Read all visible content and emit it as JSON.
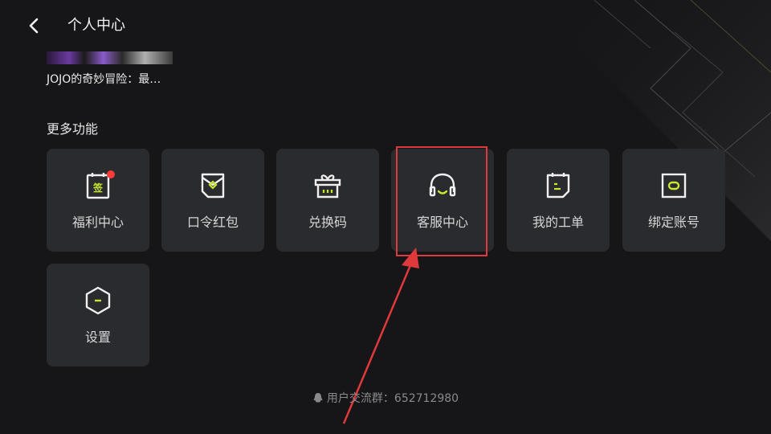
{
  "header": {
    "title": "个人中心"
  },
  "recent": {
    "video_title": "JOJO的奇妙冒险：最…"
  },
  "more": {
    "section_title": "更多功能",
    "tiles": [
      {
        "label": "福利中心",
        "icon": "welfare-icon",
        "badge": true
      },
      {
        "label": "口令红包",
        "icon": "red-envelope-icon",
        "badge": false
      },
      {
        "label": "兑换码",
        "icon": "gift-icon",
        "badge": false
      },
      {
        "label": "客服中心",
        "icon": "headset-icon",
        "badge": false
      },
      {
        "label": "我的工单",
        "icon": "ticket-icon",
        "badge": false
      },
      {
        "label": "绑定账号",
        "icon": "bind-account-icon",
        "badge": false
      },
      {
        "label": "设置",
        "icon": "settings-hexagon-icon",
        "badge": false
      }
    ]
  },
  "footer": {
    "text": "用户交流群：652712980",
    "icon": "qq-icon"
  },
  "colors": {
    "accent": "#c8e632",
    "tile_bg": "#2a2b2e",
    "badge": "#ff3b3b",
    "highlight": "#e0393b"
  }
}
